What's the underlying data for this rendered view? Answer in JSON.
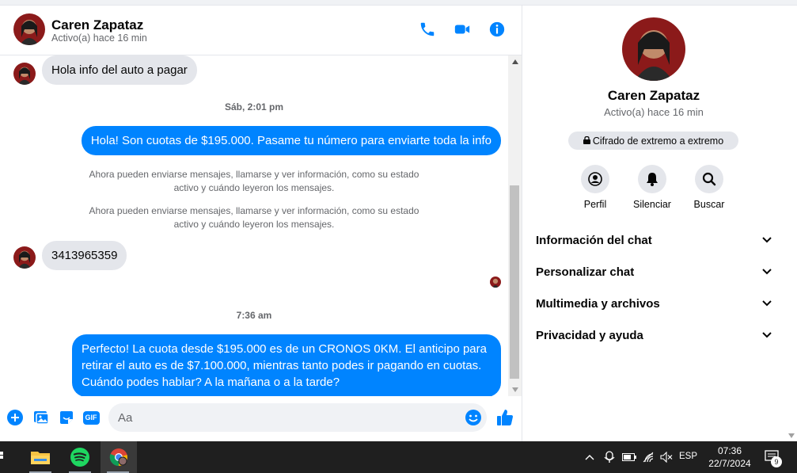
{
  "header": {
    "contact_name": "Caren Zapataz",
    "status": "Activo(a) hace 16 min",
    "call_icon": "phone-icon",
    "video_icon": "video-camera-icon",
    "info_icon": "info-icon"
  },
  "messages": {
    "incoming_1": "Hola info del auto a pagar",
    "timestamp_1": "Sáb, 2:01 pm",
    "outgoing_1": "Hola! Son cuotas de $195.000. Pasame tu número para enviarte toda la info",
    "system_1_line1": "Ahora pueden enviarse mensajes, llamarse y ver información, como su estado",
    "system_1_line2": "activo y cuándo leyeron los mensajes.",
    "system_2_line1": "Ahora pueden enviarse mensajes, llamarse y ver información, como su estado",
    "system_2_line2": "activo y cuándo leyeron los mensajes.",
    "incoming_2": "3413965359",
    "timestamp_2": "7:36 am",
    "outgoing_2_line1": "Perfecto! La cuota desde $195.000 es de un CRONOS 0KM. El anticipo para",
    "outgoing_2_line2": "retirar el auto es de $7.100.000, mientras tanto podes ir pagando en cuotas.",
    "outgoing_2_line3": "Cuándo podes hablar? A la mañana o a la tarde?"
  },
  "composer": {
    "placeholder": "Aa",
    "icons": [
      "plus-circle-icon",
      "photo-icon",
      "sticker-icon",
      "gif-icon",
      "emoji-icon",
      "thumbs-up-icon"
    ],
    "gif_label": "GIF"
  },
  "panel": {
    "name": "Caren Zapataz",
    "status": "Activo(a) hace 16 min",
    "encrypted_label": "Cifrado de extremo a extremo",
    "actions": [
      {
        "label": "Perfil",
        "icon": "profile-icon"
      },
      {
        "label": "Silenciar",
        "icon": "bell-icon"
      },
      {
        "label": "Buscar",
        "icon": "search-icon"
      }
    ],
    "sections": [
      {
        "label": "Información del chat"
      },
      {
        "label": "Personalizar chat"
      },
      {
        "label": "Multimedia y archivos"
      },
      {
        "label": "Privacidad y ayuda"
      }
    ]
  },
  "taskbar": {
    "apps": [
      "task-view-icon",
      "file-explorer-icon",
      "spotify-icon",
      "chrome-icon"
    ],
    "language": "ESP",
    "time": "07:36",
    "date": "22/7/2024",
    "notification_count": "9"
  },
  "colors": {
    "messenger_blue": "#0084ff",
    "incoming_bubble": "#e4e6eb",
    "text_secondary": "#65676b"
  }
}
